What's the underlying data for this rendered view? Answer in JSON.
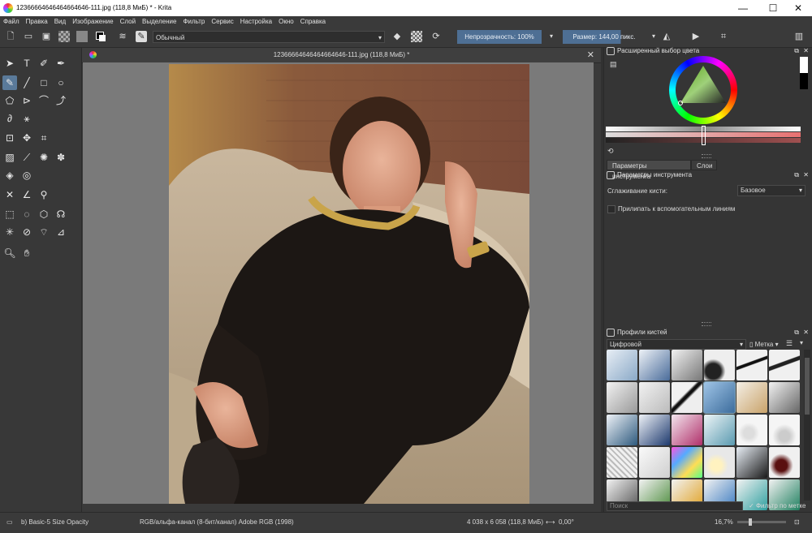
{
  "window": {
    "title": "12366664646464664646-111.jpg (118,8 МиБ) * - Krita",
    "minimize": "—",
    "maximize": "☐",
    "close": "✕"
  },
  "menu": [
    "Файл",
    "Правка",
    "Вид",
    "Изображение",
    "Слой",
    "Выделение",
    "Фильтр",
    "Сервис",
    "Настройка",
    "Окно",
    "Справка"
  ],
  "toolbar": {
    "blend_mode": "Обычный",
    "opacity_label": "Непрозрачность: 100%",
    "size_label": "Размер: 144,00 пикс."
  },
  "document": {
    "tab_title": "12366664646464664646-111.jpg (118,8 МиБ) *",
    "close_icon": "✕"
  },
  "color_docker": {
    "title": "Расширенный выбор цвета"
  },
  "tabs": [
    "Параметры инструмента",
    "Слои"
  ],
  "tool_options": {
    "title": "Параметры инструмента",
    "smoothing_label": "Сглаживание кисти:",
    "smoothing_value": "Базовое",
    "snap_label": "Прилипать к вспомогательным линиям"
  },
  "brush_presets": {
    "title": "Профили кистей",
    "category": "Цифровой",
    "tag_label": "Метка",
    "search_placeholder": "Поиск",
    "filter_label": "Фильтр по метке"
  },
  "status": {
    "brush": "b) Basic-5 Size Opacity",
    "color_space": "RGB/альфа-канал (8-бит/канал)  Adobe RGB (1998)",
    "dimensions": "4 038 x 6 058 (118,8 МиБ)",
    "rotation": "0,00°",
    "zoom": "16,7%"
  },
  "colors": {
    "accent": "#4e6f94",
    "panel": "#353535",
    "canvas_bg": "#7a7a7a"
  }
}
